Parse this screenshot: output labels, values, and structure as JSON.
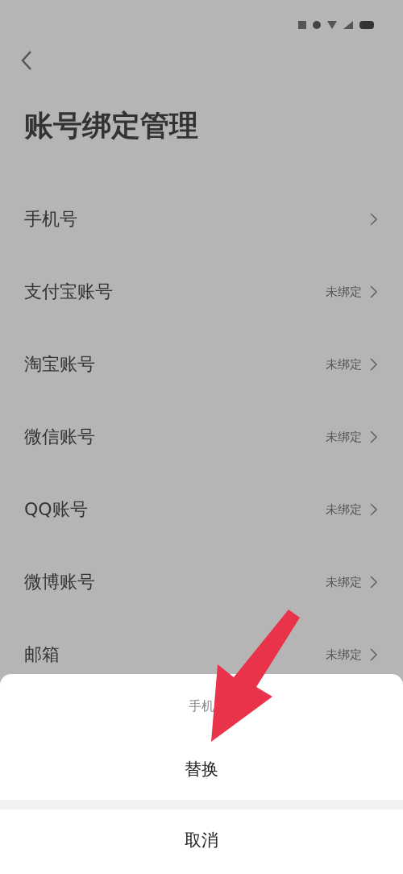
{
  "page": {
    "title": "账号绑定管理",
    "rows": [
      {
        "label": "手机号",
        "value": null
      },
      {
        "label": "支付宝账号",
        "value": "未绑定"
      },
      {
        "label": "淘宝账号",
        "value": "未绑定"
      },
      {
        "label": "微信账号",
        "value": "未绑定"
      },
      {
        "label": "QQ账号",
        "value": "未绑定"
      },
      {
        "label": "微博账号",
        "value": "未绑定"
      },
      {
        "label": "邮箱",
        "value": "未绑定"
      }
    ]
  },
  "sheet": {
    "title": "手机",
    "actions": [
      "替换",
      "取消"
    ]
  }
}
